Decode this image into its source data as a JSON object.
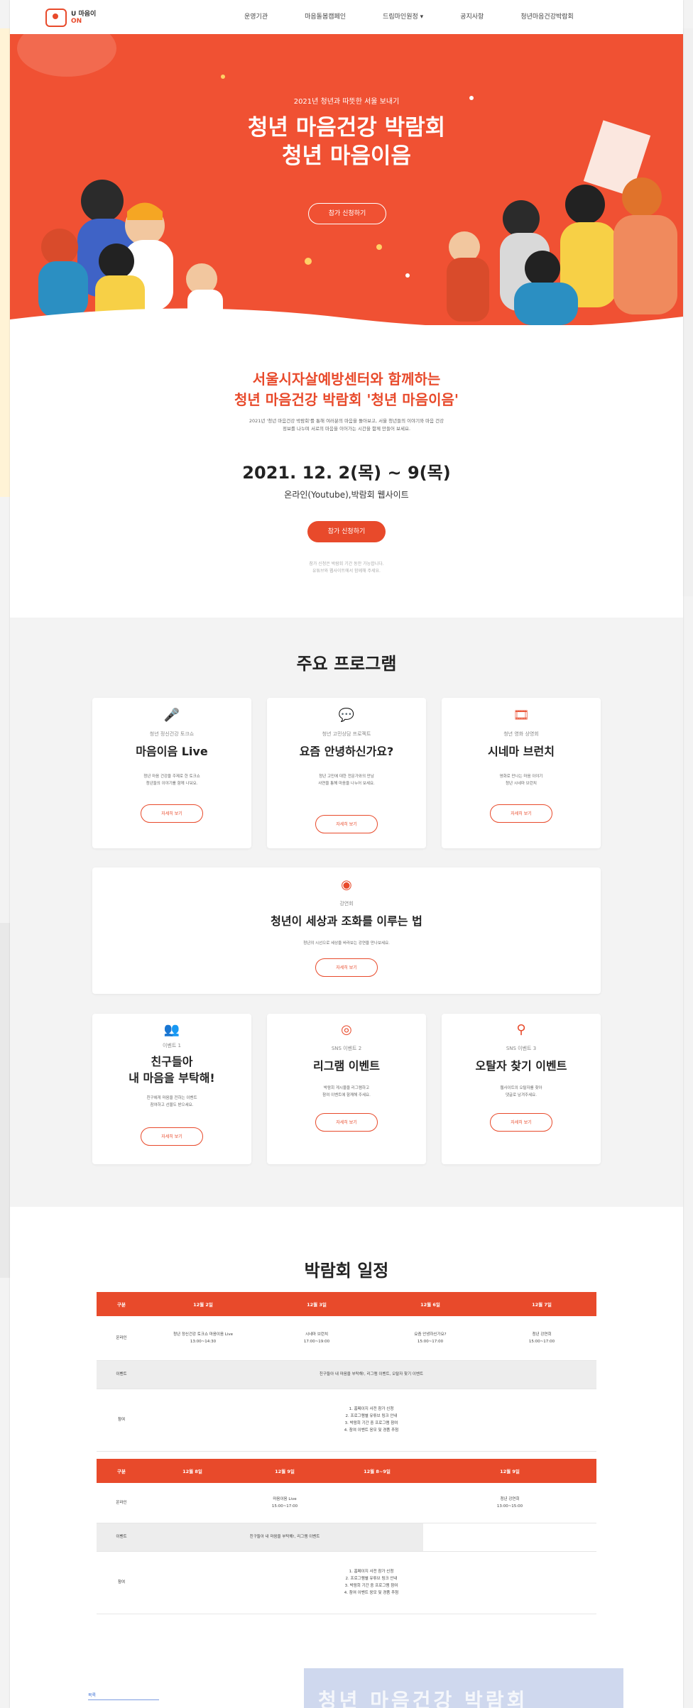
{
  "colors": {
    "accent": "#e84a2b",
    "hero_bg": "#f05133",
    "section_bg": "#f3f3f3"
  },
  "header": {
    "logo_line1": "U 마음이",
    "logo_line2": "ON",
    "nav": [
      "운영기관",
      "마음돌봄캠페인",
      "드림마인원정",
      "공지사항",
      "청년마음건강박람회"
    ],
    "nav_dropdown_icon": "chevron-down-icon"
  },
  "hero": {
    "subtitle": "2021년 청년과 따뜻한 서울 보내기",
    "title_line1": "청년 마음건강 박람회",
    "title_line2": "청년 마음이음",
    "button": "참가 신청하기"
  },
  "intro": {
    "heading_line1": "서울시자살예방센터와 함께하는",
    "heading_line2": "청년 마음건강 박람회 '청년 마음이음'",
    "desc_line1": "2021년 '청년 마음건강 박람회'를 통해 여러분의 마음을 돌아보고, 서울 청년들의 이야기와 마음 건강",
    "desc_line2": "정보를 나누며 서로의 마음을 이어가는 시간을 함께 만들어 보세요.",
    "date": "2021. 12. 2(목) ~ 9(목)",
    "place": "온라인(Youtube),박람회 웹사이트",
    "button": "참가 신청하기",
    "note_line1": "참가 신청은 박람회 기간 동안 가능합니다.",
    "note_line2": "유튜브와 웹사이트에서 함께해 주세요."
  },
  "programs": {
    "title": "주요 프로그램",
    "cards": [
      {
        "icon": "microphone-icon",
        "category": "청년 정신건강 토크쇼",
        "title": "마음이음 Live",
        "desc1": "청년 마음 건강을 주제로 한 토크쇼",
        "desc2": "청년들의 이야기를 함께 나눠요.",
        "button": "자세히 보기"
      },
      {
        "icon": "chat-bubble-icon",
        "category": "청년 고민상담 프로젝트",
        "title": "요즘 안녕하신가요?",
        "desc1": "청년 고민에 대한 전문가와의 만남",
        "desc2": "사연을 통해 마음을 나누어 보세요.",
        "button": "자세히 보기"
      },
      {
        "icon": "film-icon",
        "category": "청년 영화 상영회",
        "title": "시네마 브런치",
        "desc1": "영화로 만나는 마음 이야기",
        "desc2": "청년 시네마 브런치",
        "button": "자세히 보기"
      },
      {
        "icon": "target-icon",
        "category": "강연회",
        "title": "청년이 세상과 조화를 이루는 법",
        "desc1": "청년의 시선으로 세상을 바라보는 강연을 만나보세요.",
        "desc2": "",
        "button": "자세히 보기"
      },
      {
        "icon": "people-icon",
        "category": "이벤트 1",
        "title_line1": "친구들아",
        "title_line2": "내 마음을 부탁해!",
        "desc1": "친구에게 마음을 전하는 이벤트",
        "desc2": "참여하고 선물도 받으세요.",
        "button": "자세히 보기"
      },
      {
        "icon": "instagram-icon",
        "category": "SNS 이벤트 2",
        "title": "리그램 이벤트",
        "desc1": "박람회 게시물을 리그램하고",
        "desc2": "참여 이벤트에 함께해 주세요.",
        "button": "자세히 보기"
      },
      {
        "icon": "search-icon",
        "category": "SNS 이벤트 3",
        "title": "오탈자 찾기 이벤트",
        "desc1": "웹사이트의 오탈자를 찾아",
        "desc2": "댓글로 남겨주세요.",
        "button": "자세히 보기"
      }
    ]
  },
  "schedule": {
    "title": "박람회 일정",
    "table1": {
      "headers": [
        "구분",
        "12월 2일",
        "12월 3일",
        "12월 6일",
        "12월 7일"
      ],
      "rows": [
        {
          "label": "온라인",
          "cells": [
            "청년 정신건강 토크쇼 마음이음 Live",
            "시네마 브런치",
            "요즘 안녕하신가요?",
            "청년 강연회"
          ],
          "times": [
            "13:00~14:30",
            "17:00~19:00",
            "15:00~17:00",
            "15:00~17:00"
          ]
        },
        {
          "label": "이벤트",
          "wide": "친구들아 내 마음을 부탁해!, 리그램 이벤트, 오탈자 찾기 이벤트"
        },
        {
          "label": "참여",
          "lines": [
            "1. 홈페이지 사전 참가 신청",
            "2. 프로그램별 유튜브 링크 안내",
            "3. 박람회 기간 중 프로그램 참여",
            "4. 참여 이벤트 응모 및 경품 추첨"
          ]
        }
      ]
    },
    "table2": {
      "headers": [
        "구분",
        "12월 8일",
        "12월 9일",
        "12월 8~9일",
        "12월 9일"
      ],
      "rows": [
        {
          "label": "온라인",
          "cells": [
            "",
            "마음이음 Live",
            "",
            "청년 강연회"
          ],
          "times": [
            "",
            "15:00~17:00",
            "",
            "13:00~15:00"
          ]
        },
        {
          "label": "이벤트",
          "wide": "친구들아 내 마음을 부탁해!, 리그램 이벤트"
        },
        {
          "label": "참여",
          "lines": [
            "1. 홈페이지 사전 참가 신청",
            "2. 프로그램별 유튜브 링크 안내",
            "3. 박람회 기간 중 프로그램 참여",
            "4. 참여 이벤트 응모 및 경품 추첨"
          ]
        }
      ]
    }
  },
  "footer": {
    "link": "목록",
    "banner": "청년 마음건강 박람회"
  }
}
